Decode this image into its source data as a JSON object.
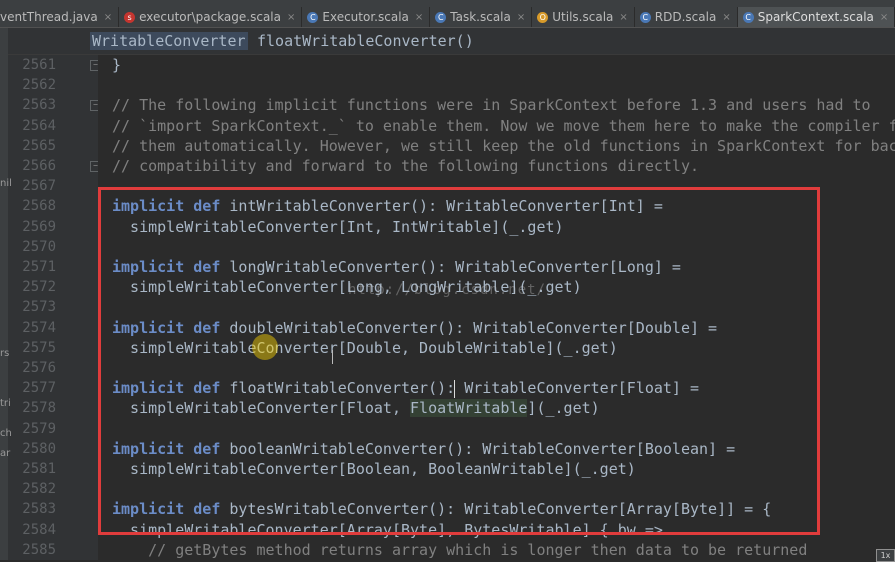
{
  "tabs": [
    {
      "label": "ventThread.java",
      "icon": "java-file-icon",
      "icon_color": "#c07b2e",
      "active": false
    },
    {
      "label": "executor\\package.scala",
      "icon": "scala-file-icon",
      "icon_color": "#c5352f",
      "active": false
    },
    {
      "label": "Executor.scala",
      "icon": "scala-class-icon",
      "icon_color": "#4a78b5",
      "active": false
    },
    {
      "label": "Task.scala",
      "icon": "scala-class-icon",
      "icon_color": "#4a78b5",
      "active": false
    },
    {
      "label": "Utils.scala",
      "icon": "scala-object-icon",
      "icon_color": "#d79a2a",
      "active": false
    },
    {
      "label": "RDD.scala",
      "icon": "scala-class-icon",
      "icon_color": "#4a78b5",
      "active": false
    },
    {
      "label": "SparkContext.scala",
      "icon": "scala-class-icon",
      "icon_color": "#4a78b5",
      "active": true
    }
  ],
  "breadcrumb": {
    "type": "WritableConverter",
    "method": "floatWritableConverter()"
  },
  "code_lines": [
    {
      "no": "2561",
      "segments": [
        {
          "t": "}",
          "c": "plain"
        }
      ]
    },
    {
      "no": "2562",
      "segments": []
    },
    {
      "no": "2563",
      "segments": [
        {
          "t": "// The following implicit functions were in SparkContext before 1.3 and users had to",
          "c": "comment"
        }
      ]
    },
    {
      "no": "2564",
      "segments": [
        {
          "t": "// `import SparkContext._` to enable them. Now we move them here to make the compiler f",
          "c": "comment"
        }
      ]
    },
    {
      "no": "2565",
      "segments": [
        {
          "t": "// them automatically. However, we still keep the old functions in SparkContext for bac",
          "c": "comment"
        }
      ]
    },
    {
      "no": "2566",
      "segments": [
        {
          "t": "// compatibility and forward to the following functions directly.",
          "c": "comment"
        }
      ]
    },
    {
      "no": "2567",
      "segments": []
    },
    {
      "no": "2568",
      "segments": [
        {
          "t": "implicit def",
          "c": "kw"
        },
        {
          "t": " intWritableConverter(): WritableConverter[Int] =",
          "c": "plain"
        }
      ]
    },
    {
      "no": "2569",
      "segments": [
        {
          "t": "  simpleWritableConverter[Int, IntWritable](_.get)",
          "c": "plain"
        }
      ]
    },
    {
      "no": "2570",
      "segments": []
    },
    {
      "no": "2571",
      "segments": [
        {
          "t": "implicit def",
          "c": "kw"
        },
        {
          "t": " longWritableConverter(): WritableConverter[Long] =",
          "c": "plain"
        }
      ]
    },
    {
      "no": "2572",
      "segments": [
        {
          "t": "  simpleWritableConverter[Long, LongWritable](_.get)",
          "c": "plain"
        }
      ]
    },
    {
      "no": "2573",
      "segments": []
    },
    {
      "no": "2574",
      "segments": [
        {
          "t": "implicit def",
          "c": "kw"
        },
        {
          "t": " doubleWritableConverter(): WritableConverter[Double] =",
          "c": "plain"
        }
      ]
    },
    {
      "no": "2575",
      "segments": [
        {
          "t": "  simpleWritableConverter[Double, DoubleWritable](_.get)",
          "c": "plain"
        }
      ]
    },
    {
      "no": "2576",
      "segments": []
    },
    {
      "no": "2577",
      "segments": [
        {
          "t": "implicit def",
          "c": "kw"
        },
        {
          "t": " floatWritableConverter(): WritableConverter[Float] =",
          "c": "plain"
        }
      ]
    },
    {
      "no": "2578",
      "segments": [
        {
          "t": "  simpleWritableConverter[Float, ",
          "c": "plain"
        },
        {
          "t": "FloatWritable",
          "c": "hl"
        },
        {
          "t": "](_.get)",
          "c": "plain"
        }
      ]
    },
    {
      "no": "2579",
      "segments": []
    },
    {
      "no": "2580",
      "segments": [
        {
          "t": "implicit def",
          "c": "kw"
        },
        {
          "t": " booleanWritableConverter(): WritableConverter[Boolean] =",
          "c": "plain"
        }
      ]
    },
    {
      "no": "2581",
      "segments": [
        {
          "t": "  simpleWritableConverter[Boolean, BooleanWritable](_.get)",
          "c": "plain"
        }
      ]
    },
    {
      "no": "2582",
      "segments": []
    },
    {
      "no": "2583",
      "segments": [
        {
          "t": "implicit def",
          "c": "kw"
        },
        {
          "t": " bytesWritableConverter(): WritableConverter[Array[Byte]] = {",
          "c": "plain"
        }
      ]
    },
    {
      "no": "2584",
      "segments": [
        {
          "t": "  simpleWritableConverter[Array[Byte], BytesWritable] { bw =>",
          "c": "plain"
        }
      ]
    },
    {
      "no": "2585",
      "segments": [
        {
          "t": "    // getBytes method returns array which is longer then data to be returned",
          "c": "comment"
        }
      ]
    }
  ],
  "watermark": "http://blog.csdn.net/",
  "left_edge_letters": [
    "nil",
    "rs",
    "tri",
    "ch",
    "ar"
  ],
  "corner_badge": "1x",
  "colors": {
    "highlight_box": "#e03c3c",
    "keyword": "#6b8cc7",
    "comment": "#808080",
    "code": "#a9b7c6"
  }
}
